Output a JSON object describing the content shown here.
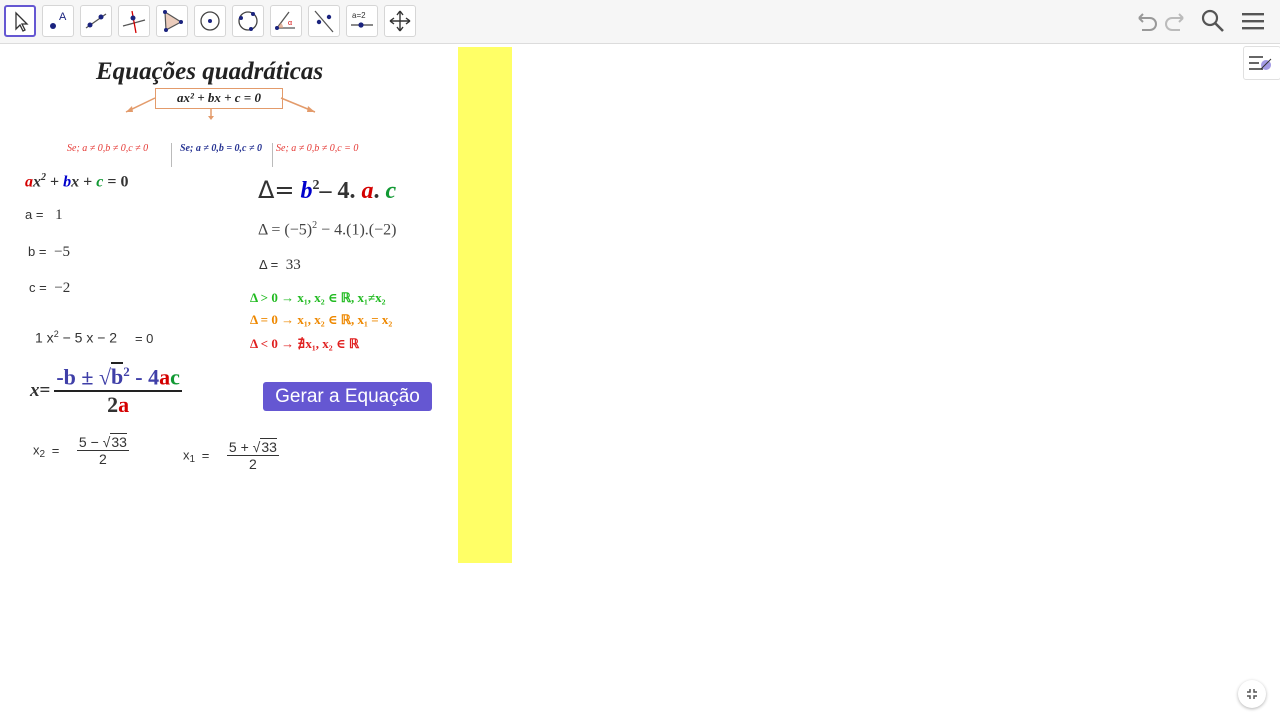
{
  "toolbar": {
    "tools": [
      {
        "name": "move-tool",
        "icon": "cursor-arrow-icon"
      },
      {
        "name": "point-tool",
        "icon": "point-icon",
        "glyph": "A"
      },
      {
        "name": "line-tool",
        "icon": "line-icon"
      },
      {
        "name": "perpendicular-line-tool",
        "icon": "perpendicular-line-icon"
      },
      {
        "name": "polygon-tool",
        "icon": "polygon-icon"
      },
      {
        "name": "circle-tool",
        "icon": "circle-icon"
      },
      {
        "name": "circle-three-points-tool",
        "icon": "circle-three-points-icon"
      },
      {
        "name": "angle-tool",
        "icon": "angle-icon"
      },
      {
        "name": "reflect-tool",
        "icon": "reflect-icon"
      },
      {
        "name": "slider-tool",
        "icon": "slider-icon",
        "glyph": "a=2"
      },
      {
        "name": "move-graphics-view-tool",
        "icon": "move-view-icon"
      }
    ],
    "right": [
      "undo-icon",
      "redo-icon",
      "search-icon",
      "menu-icon"
    ]
  },
  "header": {
    "title": "Equações quadráticas",
    "formula": "ax² + bx + c = 0",
    "case_left": "Se; a ≠ 0,b ≠ 0,c ≠ 0",
    "case_mid": "Se; a ≠ 0,b = 0,c ≠ 0",
    "case_right": "Se; a ≠ 0,b ≠ 0,c = 0"
  },
  "coeffs": {
    "general_form": {
      "a": "a",
      "x2": "x",
      "sup": "2",
      "plus1": " + ",
      "b": "b",
      "x": "x",
      "plus2": " + ",
      "c": "c",
      "eq": " = 0"
    },
    "a_label": "a =",
    "a_value": "1",
    "b_label": "b =",
    "b_value": "−5",
    "c_label": "c =",
    "c_value": "−2"
  },
  "delta": {
    "formula_head": "Δ=",
    "formula_b": "b",
    "formula_sup": "2",
    "formula_minus": "– 4.",
    "formula_a": "a",
    "formula_dot": ".",
    "formula_c": "c",
    "substituted_pre": "Δ = (−5)",
    "substituted_sup": "2",
    "substituted_post": " − 4.(1).(−2)",
    "label": "Δ =",
    "value": "33",
    "rule_pos": "Δ > 0 → x₁, x₂ ∈ ℝ, x₁≠x₂",
    "rule_zero": "Δ = 0 → x₁, x₂ ∈ ℝ, x₁ = x₂",
    "rule_neg": "Δ < 0 → ∄x₁, x₂ ∈ ℝ"
  },
  "equation": {
    "pre": "1 x",
    "sup": "2",
    "post": " − 5 x − 2",
    "eq": "= 0"
  },
  "bhaskara": {
    "x": "x",
    "eq": "=",
    "num_pre": "-b ± √",
    "b2": "b",
    "b2_sup": "2",
    "minus4": " - 4",
    "a": "a",
    "c": "c",
    "den_2": "2",
    "den_a": "a"
  },
  "roots": {
    "x2_label": "x",
    "x2_sub": "2",
    "x2_eq": "=",
    "x2_num": "5 − ",
    "x2_root": "33",
    "x2_den": "2",
    "x1_label": "x",
    "x1_sub": "1",
    "x1_eq": "=",
    "x1_num": "5 + ",
    "x1_root": "33",
    "x1_den": "2"
  },
  "button": {
    "label": "Gerar a Equação"
  },
  "colors": {
    "accent": "#6557d2",
    "highlight": "#ffff66",
    "red": "#d40000",
    "blue": "#0000cc",
    "green": "#119933",
    "orange": "#ee8800"
  }
}
